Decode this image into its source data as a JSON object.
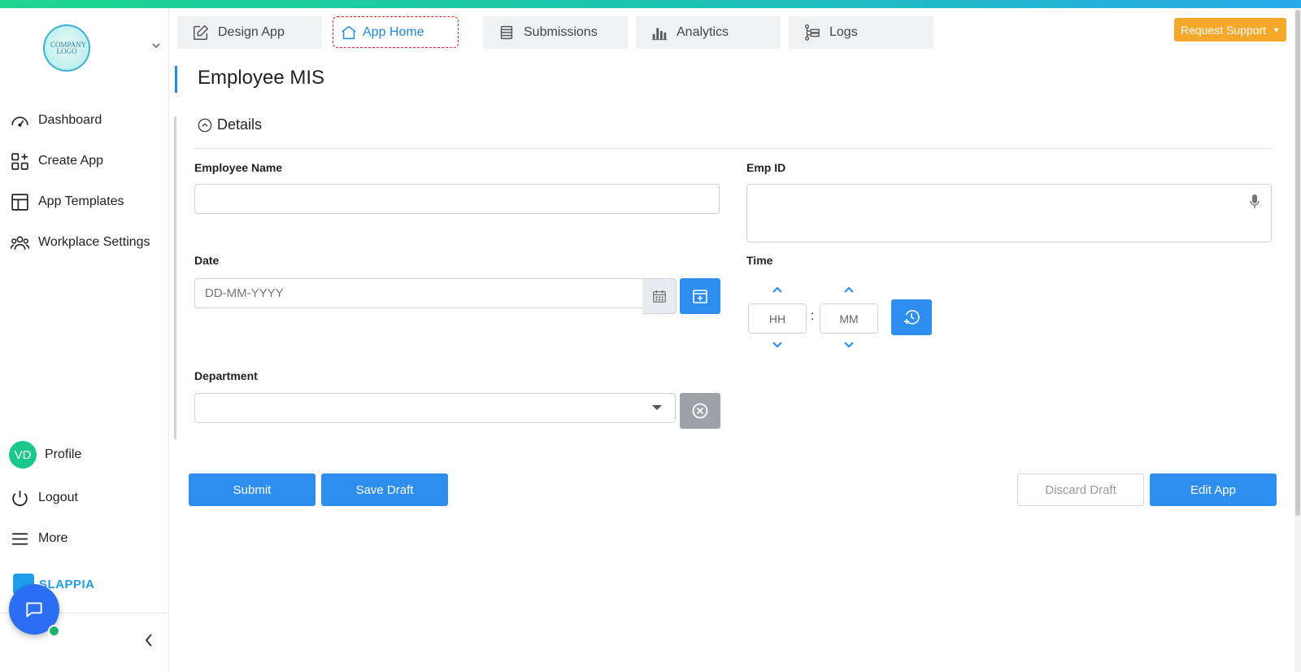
{
  "sidebar": {
    "logo_text": "COMPANY LOGO",
    "nav": [
      {
        "label": "Dashboard",
        "icon": "gauge-icon"
      },
      {
        "label": "Create App",
        "icon": "grid-plus-icon"
      },
      {
        "label": "App Templates",
        "icon": "layout-icon"
      },
      {
        "label": "Workplace Settings",
        "icon": "users-icon"
      }
    ],
    "profile": {
      "initials": "VD",
      "label": "Profile"
    },
    "logout_label": "Logout",
    "more_label": "More",
    "brand": "SLAPPIA"
  },
  "tabs": [
    {
      "label": "Design App",
      "icon": "edit-icon"
    },
    {
      "label": "App Home",
      "icon": "home-icon",
      "active": true
    },
    {
      "label": "Submissions",
      "icon": "stack-icon"
    },
    {
      "label": "Analytics",
      "icon": "bar-chart-icon"
    },
    {
      "label": "Logs",
      "icon": "logs-icon"
    }
  ],
  "support_button": "Request Support",
  "page": {
    "title": "Employee MIS",
    "section": "Details"
  },
  "form": {
    "employee_name": {
      "label": "Employee Name",
      "value": ""
    },
    "emp_id": {
      "label": "Emp ID",
      "value": ""
    },
    "date": {
      "label": "Date",
      "placeholder": "DD-MM-YYYY"
    },
    "time": {
      "label": "Time",
      "hh_placeholder": "HH",
      "mm_placeholder": "MM",
      "separator": ":"
    },
    "department": {
      "label": "Department",
      "value": ""
    }
  },
  "actions": {
    "submit": "Submit",
    "save_draft": "Save Draft",
    "discard_draft": "Discard Draft",
    "edit_app": "Edit App"
  },
  "colors": {
    "accent": "#2d8ef0",
    "support": "#f6a82a",
    "brand": "#1e9de8",
    "avatar": "#1ac98a"
  }
}
